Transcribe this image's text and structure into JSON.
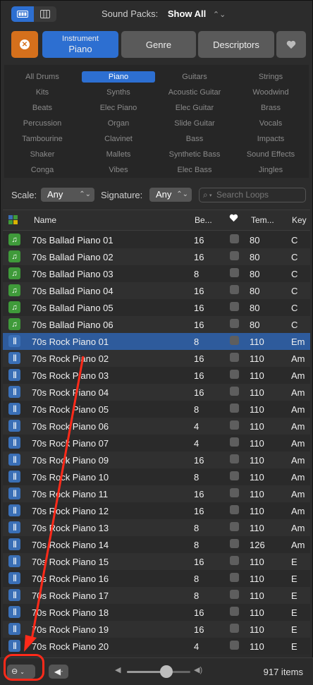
{
  "toolbar": {
    "sound_packs_label": "Sound Packs:",
    "sound_packs_value": "Show All"
  },
  "filters": {
    "instrument_small": "Instrument",
    "instrument_value": "Piano",
    "genre": "Genre",
    "descriptors": "Descriptors"
  },
  "keywords": [
    [
      "All Drums",
      "Piano",
      "Guitars",
      "Strings"
    ],
    [
      "Kits",
      "Synths",
      "Acoustic Guitar",
      "Woodwind"
    ],
    [
      "Beats",
      "Elec Piano",
      "Elec Guitar",
      "Brass"
    ],
    [
      "Percussion",
      "Organ",
      "Slide Guitar",
      "Vocals"
    ],
    [
      "Tambourine",
      "Clavinet",
      "Bass",
      "Impacts"
    ],
    [
      "Shaker",
      "Mallets",
      "Synthetic Bass",
      "Sound Effects"
    ],
    [
      "Conga",
      "Vibes",
      "Elec Bass",
      "Jingles"
    ]
  ],
  "selected_keyword": "Piano",
  "scale": {
    "label": "Scale:",
    "value": "Any"
  },
  "signature": {
    "label": "Signature:",
    "value": "Any"
  },
  "search": {
    "placeholder": "Search Loops"
  },
  "table": {
    "headers": {
      "name": "Name",
      "beats": "Be...",
      "tempo": "Tem...",
      "key": "Key"
    },
    "rows": [
      {
        "type": "midi",
        "name": "70s Ballad Piano 01",
        "beats": "16",
        "tempo": "80",
        "key": "C"
      },
      {
        "type": "midi",
        "name": "70s Ballad Piano 02",
        "beats": "16",
        "tempo": "80",
        "key": "C"
      },
      {
        "type": "midi",
        "name": "70s Ballad Piano 03",
        "beats": "8",
        "tempo": "80",
        "key": "C"
      },
      {
        "type": "midi",
        "name": "70s Ballad Piano 04",
        "beats": "16",
        "tempo": "80",
        "key": "C"
      },
      {
        "type": "midi",
        "name": "70s Ballad Piano 05",
        "beats": "16",
        "tempo": "80",
        "key": "C"
      },
      {
        "type": "midi",
        "name": "70s Ballad Piano 06",
        "beats": "16",
        "tempo": "80",
        "key": "C"
      },
      {
        "type": "audio",
        "name": "70s Rock Piano 01",
        "beats": "8",
        "tempo": "110",
        "key": "Em",
        "selected": true
      },
      {
        "type": "audio",
        "name": "70s Rock Piano 02",
        "beats": "16",
        "tempo": "110",
        "key": "Am"
      },
      {
        "type": "audio",
        "name": "70s Rock Piano 03",
        "beats": "16",
        "tempo": "110",
        "key": "Am"
      },
      {
        "type": "audio",
        "name": "70s Rock Piano 04",
        "beats": "16",
        "tempo": "110",
        "key": "Am"
      },
      {
        "type": "audio",
        "name": "70s Rock Piano 05",
        "beats": "8",
        "tempo": "110",
        "key": "Am"
      },
      {
        "type": "audio",
        "name": "70s Rock Piano 06",
        "beats": "4",
        "tempo": "110",
        "key": "Am"
      },
      {
        "type": "audio",
        "name": "70s Rock Piano 07",
        "beats": "4",
        "tempo": "110",
        "key": "Am"
      },
      {
        "type": "audio",
        "name": "70s Rock Piano 09",
        "beats": "16",
        "tempo": "110",
        "key": "Am"
      },
      {
        "type": "audio",
        "name": "70s Rock Piano 10",
        "beats": "8",
        "tempo": "110",
        "key": "Am"
      },
      {
        "type": "audio",
        "name": "70s Rock Piano 11",
        "beats": "16",
        "tempo": "110",
        "key": "Am"
      },
      {
        "type": "audio",
        "name": "70s Rock Piano 12",
        "beats": "16",
        "tempo": "110",
        "key": "Am"
      },
      {
        "type": "audio",
        "name": "70s Rock Piano 13",
        "beats": "8",
        "tempo": "110",
        "key": "Am"
      },
      {
        "type": "audio",
        "name": "70s Rock Piano 14",
        "beats": "8",
        "tempo": "126",
        "key": "Am"
      },
      {
        "type": "audio",
        "name": "70s Rock Piano 15",
        "beats": "16",
        "tempo": "110",
        "key": "E"
      },
      {
        "type": "audio",
        "name": "70s Rock Piano 16",
        "beats": "8",
        "tempo": "110",
        "key": "E"
      },
      {
        "type": "audio",
        "name": "70s Rock Piano 17",
        "beats": "8",
        "tempo": "110",
        "key": "E"
      },
      {
        "type": "audio",
        "name": "70s Rock Piano 18",
        "beats": "16",
        "tempo": "110",
        "key": "E"
      },
      {
        "type": "audio",
        "name": "70s Rock Piano 19",
        "beats": "16",
        "tempo": "110",
        "key": "E"
      },
      {
        "type": "audio",
        "name": "70s Rock Piano 20",
        "beats": "4",
        "tempo": "110",
        "key": "E"
      }
    ]
  },
  "footer": {
    "item_count": "917 items",
    "volume_level": 0.62
  },
  "colors": {
    "accent": "#2d6fd1",
    "reset": "#d5701c",
    "annotation": "#ff2a1a",
    "midi_icon": "#3f9a3a",
    "audio_icon": "#3a6fb6"
  }
}
